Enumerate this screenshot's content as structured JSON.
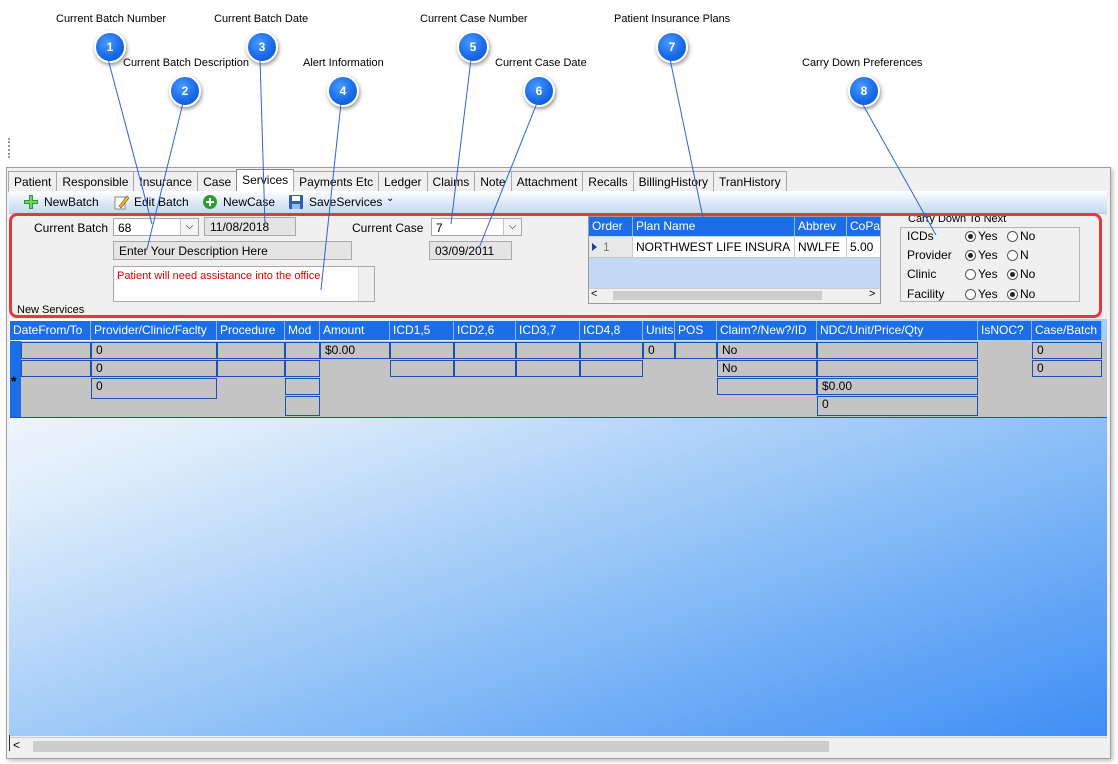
{
  "callouts": [
    {
      "label": "Current Batch Number",
      "num": "1"
    },
    {
      "label": "Current Batch Description",
      "num": "2"
    },
    {
      "label": "Current Batch Date",
      "num": "3"
    },
    {
      "label": "Alert Information",
      "num": "4"
    },
    {
      "label": "Current Case Number",
      "num": "5"
    },
    {
      "label": "Current Case Date",
      "num": "6"
    },
    {
      "label": "Patient Insurance Plans",
      "num": "7"
    },
    {
      "label": "Carry Down Preferences",
      "num": "8"
    }
  ],
  "tabs": [
    "Patient",
    "Responsible",
    "Insurance",
    "Case",
    "Services",
    "Payments Etc",
    "Ledger",
    "Claims",
    "Note",
    "Attachment",
    "Recalls",
    "BillingHistory",
    "TranHistory"
  ],
  "active_tab": "Services",
  "toolbar": {
    "new_batch": "NewBatch",
    "edit_batch": "Edit Batch",
    "new_case": "NewCase",
    "save_services": "SaveServices",
    "more": "⌄"
  },
  "batch": {
    "label": "Current Batch",
    "number": "68",
    "date": "11/08/2018",
    "description": "Enter Your Description Here",
    "alert": "Patient will need assistance into the office."
  },
  "case": {
    "label": "Current Case",
    "number": "7",
    "date": "03/09/2011"
  },
  "plans": {
    "headers": [
      "Order",
      "Plan Name",
      "Abbrev",
      "CoPay"
    ],
    "rows": [
      [
        "1",
        "NORTHWEST LIFE INSURA",
        "NWLFE",
        "5.00"
      ]
    ]
  },
  "carry_down": {
    "title": "Carry Down To Next",
    "rows": [
      {
        "label": "ICDs",
        "yes": "Yes",
        "no": "No",
        "selected": "yes"
      },
      {
        "label": "Provider",
        "yes": "Yes",
        "no": "N",
        "selected": "yes"
      },
      {
        "label": "Clinic",
        "yes": "Yes",
        "no": "No",
        "selected": "no"
      },
      {
        "label": "Facility",
        "yes": "Yes",
        "no": "No",
        "selected": "no"
      }
    ]
  },
  "new_services_label": "New Services",
  "grid": {
    "headers": [
      "DateFrom/To",
      "Provider/Clinic/Faclty",
      "Procedure",
      "Mod",
      "Amount",
      "ICD1,5",
      "ICD2,6",
      "ICD3,7",
      "ICD4,8",
      "Units",
      "POS",
      "Claim?/New?/ID",
      "NDC/Unit/Price/Qty",
      "IsNOC?",
      "Case/Batch"
    ],
    "values": {
      "provider": "0",
      "clinic": "0",
      "facility": "0",
      "amount": "$0.00",
      "units": "0",
      "claim": "No",
      "new": "No",
      "ndc_price": "$0.00",
      "ndc_qty": "0",
      "case": "0",
      "batch": "0",
      "new_row_marker": "*"
    }
  },
  "scroll": {
    "left_arrow": "<",
    "right_arrow": ">"
  },
  "colors": {
    "header_blue": "#1b6ee8",
    "highlight_red": "#e0393e",
    "alert_red": "#e00000",
    "bubble_blue": "#1a6be8"
  }
}
